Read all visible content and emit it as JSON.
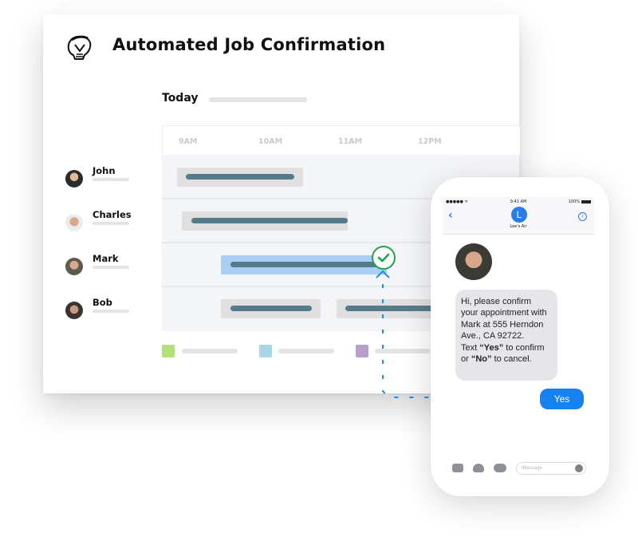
{
  "app": {
    "title": "Automated Job Confirmation",
    "logo_icon": "spartan-helmet-icon"
  },
  "schedule": {
    "day_label": "Today",
    "times": [
      "9AM",
      "10AM",
      "11AM",
      "12PM"
    ],
    "people": [
      {
        "name": "John"
      },
      {
        "name": "Charles"
      },
      {
        "name": "Mark"
      },
      {
        "name": "Bob"
      }
    ],
    "legend_colors": [
      "#b3e27d",
      "#a7d6e4",
      "#b6a0cb"
    ],
    "highlight_color": "#a9cff6",
    "confirm_color": "#1ea34a",
    "connector_color": "#1a8ee8"
  },
  "phone": {
    "status_carrier": "●●●●● ᯤ",
    "status_time": "9:41 AM",
    "status_battery": "100%",
    "contact_initial": "L",
    "contact_name": "Lee's Air",
    "message_lines": [
      "Hi, please confirm",
      "your appointment with",
      "Mark at 555 Herndon",
      "Ave., CA 92722."
    ],
    "message_text_prefix": "Text ",
    "message_yes": "“Yes”",
    "message_mid": " to confirm",
    "message_or": "or ",
    "message_no": "“No”",
    "message_end": " to cancel.",
    "reply": "Yes",
    "input_placeholder": "iMessage",
    "accent": "#1681f0"
  }
}
